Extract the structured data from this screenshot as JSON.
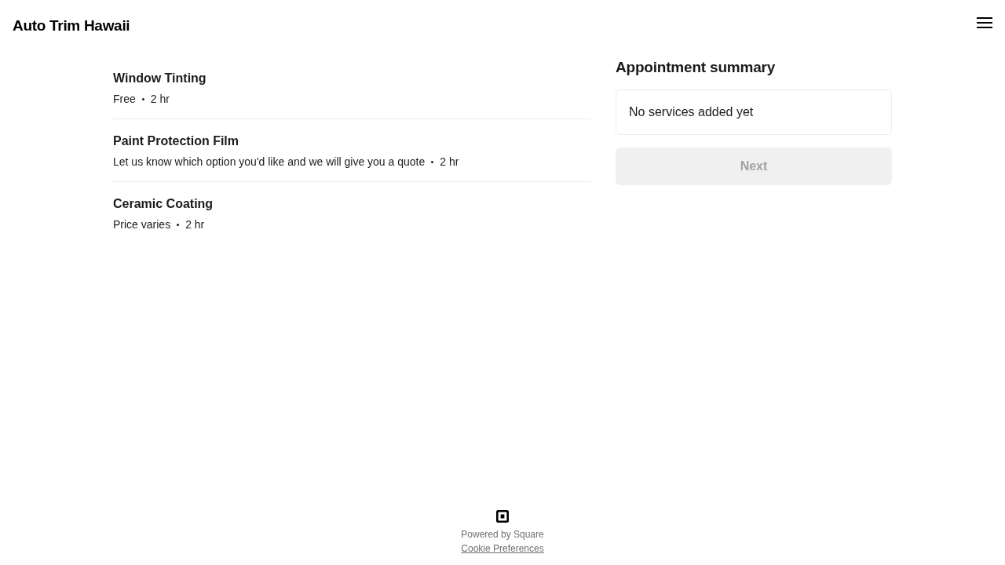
{
  "header": {
    "business_name": "Auto Trim Hawaii"
  },
  "services": [
    {
      "name": "Window Tinting",
      "price": "Free",
      "duration": "2 hr"
    },
    {
      "name": "Paint Protection Film",
      "price": "Let us know which option you'd like and we will give you a quote",
      "duration": "2 hr"
    },
    {
      "name": "Ceramic Coating",
      "price": "Price varies",
      "duration": "2 hr"
    }
  ],
  "summary": {
    "title": "Appointment summary",
    "empty_message": "No services added yet",
    "next_button": {
      "label": "Next",
      "disabled": true
    }
  },
  "footer": {
    "powered_by": "Powered by Square",
    "cookie_link": "Cookie Preferences"
  }
}
